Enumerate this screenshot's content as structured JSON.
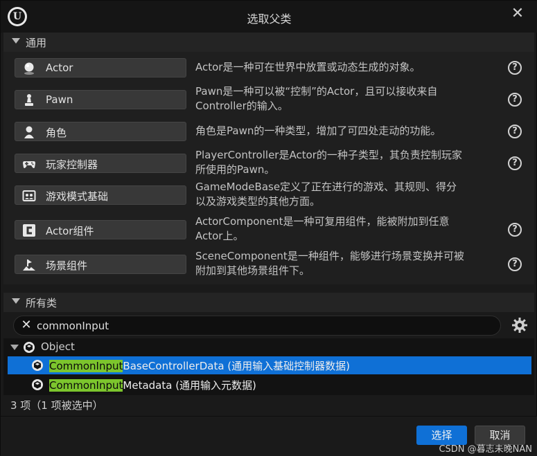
{
  "window": {
    "title": "选取父类"
  },
  "common": {
    "header": "通用",
    "classes": [
      {
        "icon": "actor-sphere-icon",
        "label": "Actor",
        "desc_lines": [
          "Actor是一种可在世界中放置或动态生成的对象。"
        ],
        "has_help": true
      },
      {
        "icon": "pawn-icon",
        "label": "Pawn",
        "desc_lines": [
          "Pawn是一种可以被“控制”的Actor，且可以接收来自",
          "Controller的输入。"
        ],
        "has_help": true
      },
      {
        "icon": "character-icon",
        "label": "角色",
        "desc_lines": [
          "角色是Pawn的一种类型，增加了可四处走动的功能。"
        ],
        "has_help": true
      },
      {
        "icon": "gamepad-icon",
        "label": "玩家控制器",
        "desc_lines": [
          "PlayerController是Actor的一种子类型，其负责控制玩家",
          "所使用的Pawn。"
        ],
        "has_help": true
      },
      {
        "icon": "game-mode-icon",
        "label": "游戏模式基础",
        "desc_lines": [
          "GameModeBase定义了正在进行的游戏、其规则、得分",
          "以及游戏类型的其他方面。"
        ],
        "has_help": false
      },
      {
        "icon": "actor-component-icon",
        "label": "Actor组件",
        "desc_lines": [
          "ActorComponent是一种可复用组件，能被附加到任意",
          "Actor上。"
        ],
        "has_help": true
      },
      {
        "icon": "scene-component-icon",
        "label": "场景组件",
        "desc_lines": [
          "SceneComponent是一种组件，能够进行场景变换并可被",
          "附加到其他场景组件下。"
        ],
        "has_help": true
      }
    ]
  },
  "all_classes": {
    "header": "所有类",
    "search_value": "commonInput",
    "tree_root": "Object",
    "items": [
      {
        "match": "CommonInput",
        "rest": "BaseControllerData (通用输入基础控制器数据)",
        "selected": true
      },
      {
        "match": "CommonInput",
        "rest": "Metadata (通用输入元数据)",
        "selected": false
      }
    ],
    "status": "3 项（1 项被选中）"
  },
  "footer": {
    "select_label": "选择",
    "cancel_label": "取消",
    "watermark": "CSDN @暮志未晚NAN"
  },
  "colors": {
    "accent": "#0f70d6",
    "match_highlight": "#7cc52d",
    "background": "#1a1a1a"
  }
}
